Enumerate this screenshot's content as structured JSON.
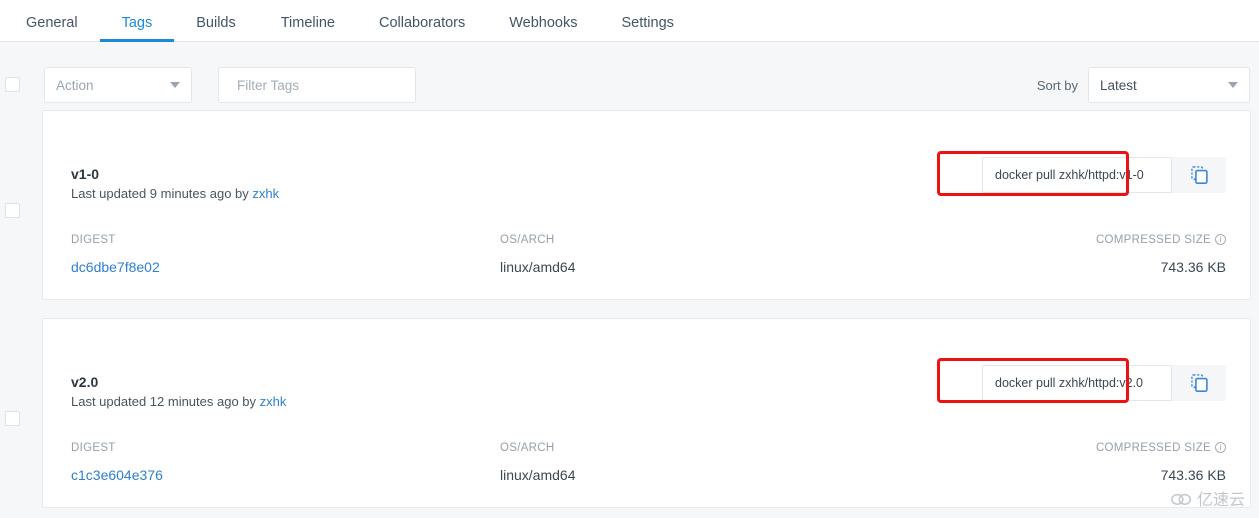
{
  "tabs": [
    {
      "label": "General",
      "active": false
    },
    {
      "label": "Tags",
      "active": true
    },
    {
      "label": "Builds",
      "active": false
    },
    {
      "label": "Timeline",
      "active": false
    },
    {
      "label": "Collaborators",
      "active": false
    },
    {
      "label": "Webhooks",
      "active": false
    },
    {
      "label": "Settings",
      "active": false
    }
  ],
  "toolbar": {
    "action_label": "Action",
    "filter_placeholder": "Filter Tags",
    "filter_value": "",
    "sort_by_label": "Sort by",
    "sort_value": "Latest",
    "search_icon": "search-icon",
    "caret_icon": "chevron-down-icon"
  },
  "columns": {
    "digest": "DIGEST",
    "os_arch": "OS/ARCH",
    "compressed_size": "COMPRESSED SIZE"
  },
  "tags": [
    {
      "name": "v1-0",
      "updated": "Last updated 9 minutes ago by ",
      "updated_by": "zxhk",
      "pull_command": "docker pull zxhk/httpd:v1-0",
      "digest": "dc6dbe7f8e02",
      "os_arch": "linux/amd64",
      "size": "743.36 KB",
      "copy_icon": "copy-icon"
    },
    {
      "name": "v2.0",
      "updated": "Last updated 12 minutes ago by ",
      "updated_by": "zxhk",
      "pull_command": "docker pull zxhk/httpd:v2.0",
      "digest": "c1c3e604e376",
      "os_arch": "linux/amd64",
      "size": "743.36 KB",
      "copy_icon": "copy-icon"
    }
  ],
  "watermark": {
    "text": "亿速云",
    "icon": "cloud-icon"
  },
  "colors": {
    "accent": "#1d8ad6",
    "link": "#2f80d0",
    "annotation": "#ee1111",
    "page_bg": "#f5f7f9"
  }
}
